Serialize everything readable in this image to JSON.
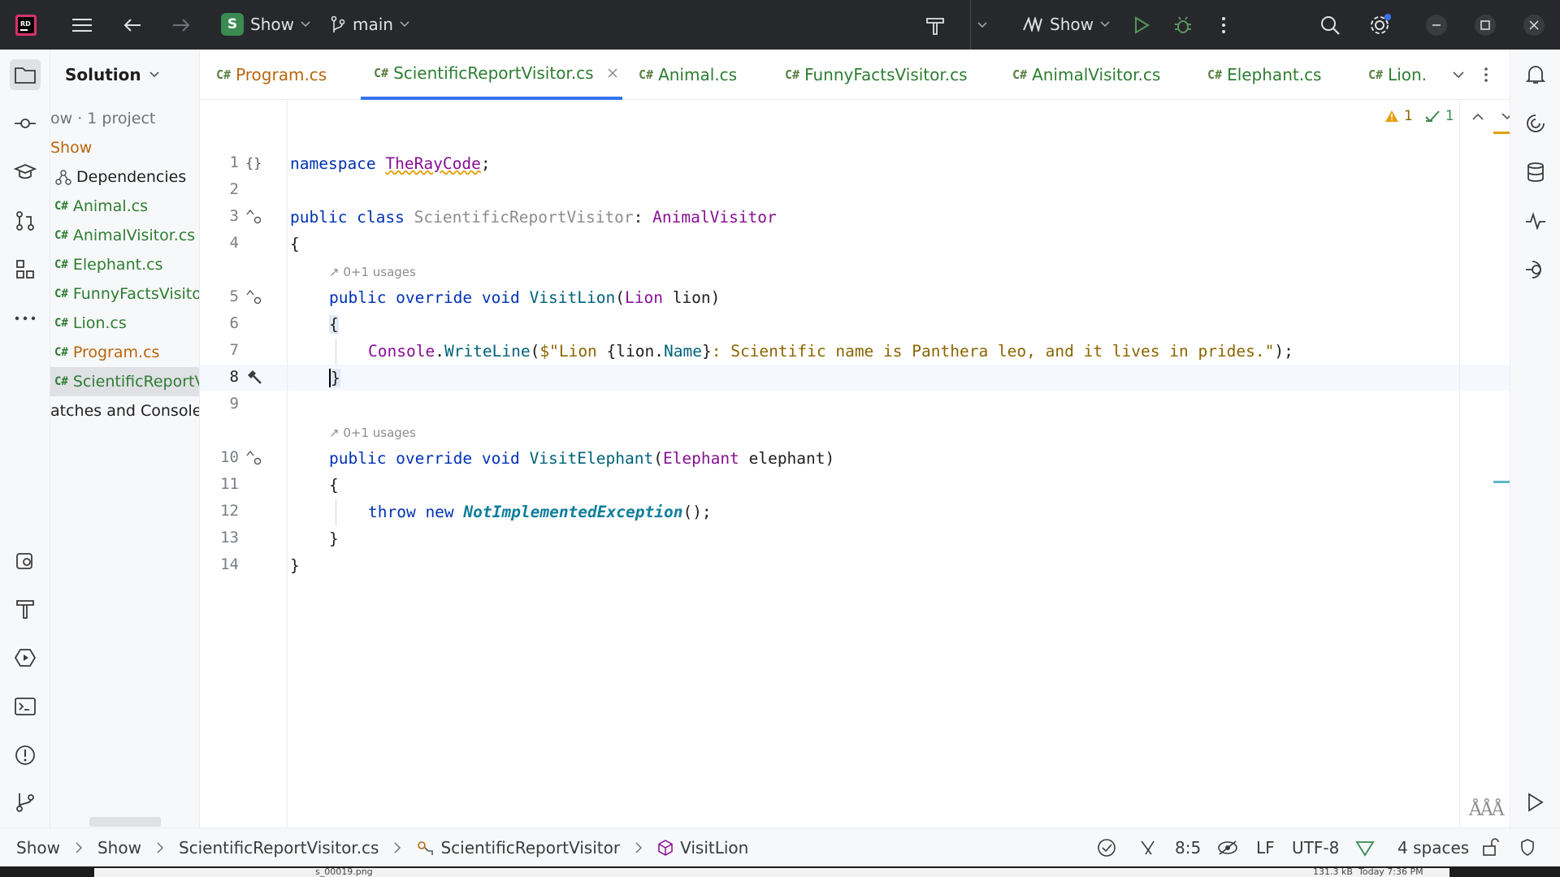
{
  "topbar": {
    "project_name": "Show",
    "project_initial": "S",
    "branch": "main",
    "run_config": "Show"
  },
  "project_panel": {
    "title": "Solution",
    "root": "ow · 1 project",
    "project": "Show",
    "dependencies": "Dependencies",
    "files": [
      "Animal.cs",
      "AnimalVisitor.cs",
      "Elephant.cs",
      "FunnyFactsVisito",
      "Lion.cs",
      "Program.cs",
      "ScientificReportV"
    ],
    "scratches": "atches and Consoles",
    "cs_label": "C#"
  },
  "tabs": [
    {
      "label": "Program.cs",
      "active": false
    },
    {
      "label": "ScientificReportVisitor.cs",
      "active": true
    },
    {
      "label": "Animal.cs",
      "active": false
    },
    {
      "label": "FunnyFactsVisitor.cs",
      "active": false
    },
    {
      "label": "AnimalVisitor.cs",
      "active": false
    },
    {
      "label": "Elephant.cs",
      "active": false
    },
    {
      "label": "Lion.",
      "active": false
    }
  ],
  "inspections": {
    "warnings": "1",
    "ok": "1"
  },
  "code": {
    "line_numbers": [
      "1",
      "2",
      "3",
      "4",
      "5",
      "6",
      "7",
      "8",
      "9",
      "10",
      "11",
      "12",
      "13",
      "14"
    ],
    "usages_hint": "0+1 usages",
    "l1_kw": "namespace",
    "l1_ns": "TheRayCode",
    "l1_end": ";",
    "l3_kw": "public class",
    "l3_cls": "ScientificReportVisitor",
    "l3_sep": ": ",
    "l3_base": "AnimalVisitor",
    "brace_open": "{",
    "brace_close": "}",
    "l5_kw": "public override void",
    "l5_fn": "VisitLion",
    "l5_p1": "(",
    "l5_ty": "Lion",
    "l5_p2": " lion)",
    "l7_cls": "Console",
    "l7_dot": ".",
    "l7_fn": "WriteLine",
    "l7_open": "(",
    "l7_s1": "$\"Lion ",
    "l7_i1": "{lion.",
    "l7_prop": "Name",
    "l7_i2": "}",
    "l7_s2": ": Scientific name is Panthera leo, and it lives in prides.\"",
    "l7_end": ");",
    "l10_kw": "public override void",
    "l10_fn": "VisitElephant",
    "l10_p1": "(",
    "l10_ty": "Elephant",
    "l10_p2": " elephant)",
    "l12_kw": "throw new",
    "l12_ex": "NotImplementedException",
    "l12_end": "();"
  },
  "statusbar": {
    "crumbs": [
      "Show",
      "Show",
      "ScientificReportVisitor.cs",
      "ScientificReportVisitor",
      "VisitLion"
    ],
    "position": "8:5",
    "line_sep": "LF",
    "encoding": "UTF-8",
    "indent": "4 spaces"
  },
  "taskstrip": {
    "file": "s_00019.png",
    "size": "131.3 kB",
    "date": "Today 7:36 PM"
  }
}
